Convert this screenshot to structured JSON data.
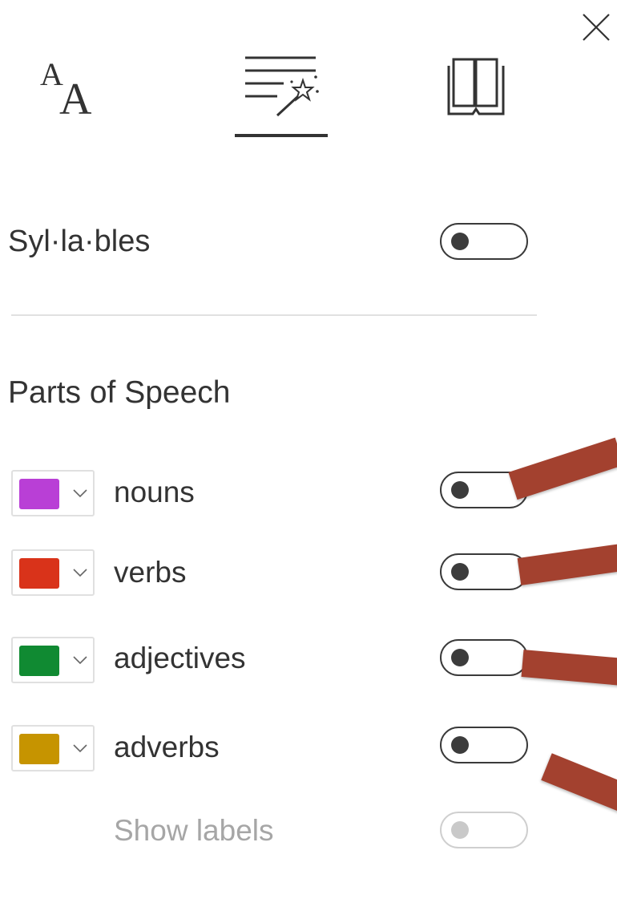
{
  "close": {
    "icon": "close-icon"
  },
  "tabs": [
    {
      "icon": "text-preferences-icon",
      "selected": false,
      "glyph_big": "A",
      "glyph_small": "A"
    },
    {
      "icon": "grammar-options-icon",
      "selected": true
    },
    {
      "icon": "reading-preferences-icon",
      "selected": false
    }
  ],
  "syllables": {
    "label": "Syl·la·bles",
    "on": false
  },
  "parts_of_speech": {
    "title": "Parts of Speech",
    "items": [
      {
        "label": "nouns",
        "color": "#b93fd6",
        "on": false
      },
      {
        "label": "verbs",
        "color": "#d9331a",
        "on": false
      },
      {
        "label": "adjectives",
        "color": "#108a32",
        "on": false
      },
      {
        "label": "adverbs",
        "color": "#c69400",
        "on": false
      }
    ],
    "show_labels": {
      "label": "Show labels",
      "on": false,
      "disabled": true
    }
  },
  "colors": {
    "text": "#333333",
    "muted_text": "#a6a6a6",
    "divider": "#e1e1e1",
    "annotation": "#a3412f"
  }
}
